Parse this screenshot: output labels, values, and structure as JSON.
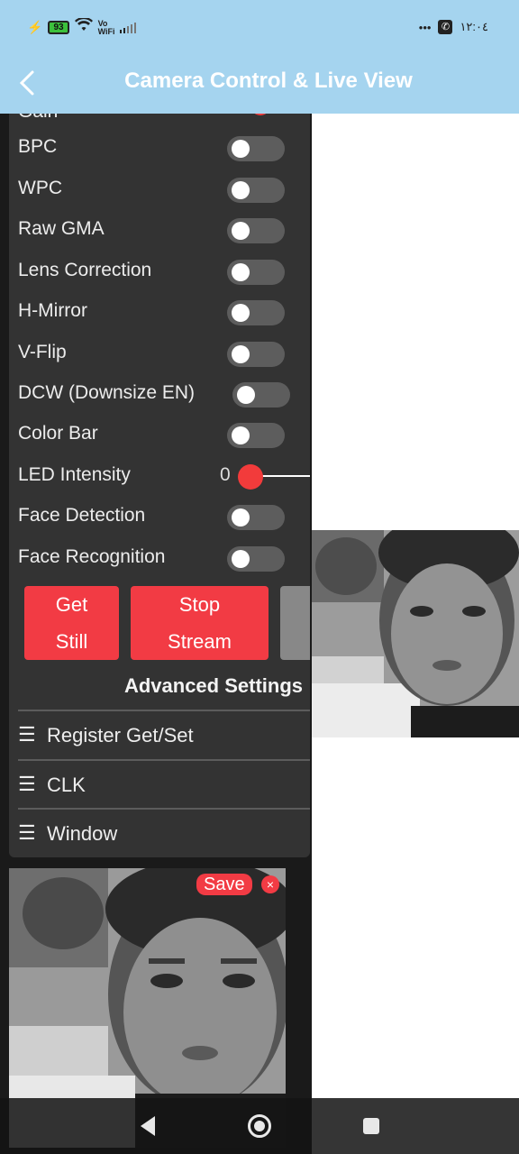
{
  "status_bar": {
    "battery": "93",
    "wifi_label_top": "Vo",
    "wifi_label_bottom": "WiFi",
    "dots": "•••",
    "time": "١٢:٠٤"
  },
  "header": {
    "title": "Camera Control & Live View"
  },
  "controls": {
    "cut_off_label": "Gain",
    "toggles": [
      {
        "label": "BPC",
        "on": false
      },
      {
        "label": "WPC",
        "on": false
      },
      {
        "label": "Raw GMA",
        "on": false
      },
      {
        "label": "Lens Correction",
        "on": false
      },
      {
        "label": "H-Mirror",
        "on": false
      },
      {
        "label": "V-Flip",
        "on": false
      },
      {
        "label": "DCW (Downsize EN)",
        "on": false
      },
      {
        "label": "Color Bar",
        "on": false
      }
    ],
    "led": {
      "label": "LED Intensity",
      "value": "0"
    },
    "face_toggles": [
      {
        "label": "Face Detection",
        "on": false
      },
      {
        "label": "Face Recognition",
        "on": false
      }
    ]
  },
  "buttons": {
    "get_still_line1": "Get",
    "get_still_line2": "Still",
    "stop_stream_line1": "Stop",
    "stop_stream_line2": "Stream"
  },
  "advanced": {
    "title": "Advanced Settings",
    "menu": [
      "Register Get/Set",
      "CLK",
      "Window"
    ],
    "menu_icon": "☰"
  },
  "still": {
    "save_label": "Save",
    "close_glyph": "×"
  },
  "colors": {
    "accent": "#f23b44",
    "header_bg": "#a5d4ef",
    "panel_bg": "#333333"
  }
}
